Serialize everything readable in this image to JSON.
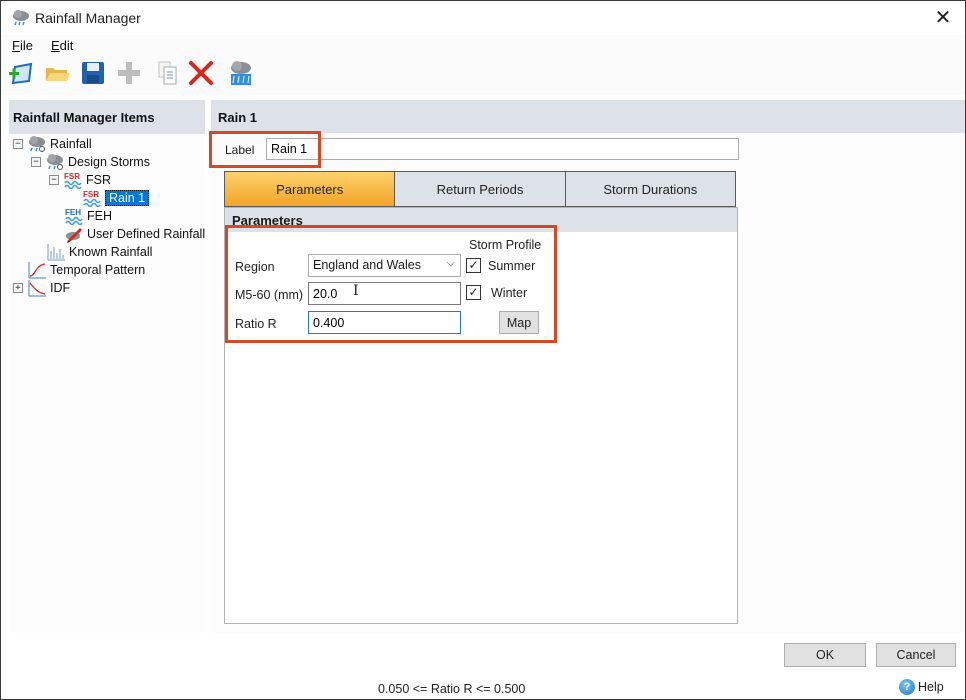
{
  "window": {
    "title": "Rainfall Manager"
  },
  "menu": {
    "file": "File",
    "edit": "Edit"
  },
  "toolbar": {
    "buttons": [
      {
        "icon": "new-icon",
        "label": "New"
      },
      {
        "icon": "open-folder-icon",
        "label": "Open"
      },
      {
        "icon": "save-icon",
        "label": "Save"
      },
      {
        "icon": "add-icon",
        "label": "Add"
      },
      {
        "icon": "copy-icon",
        "label": "Copy"
      },
      {
        "icon": "delete-icon",
        "label": "Delete"
      },
      {
        "icon": "rainfall-icon",
        "label": "Rainfall"
      }
    ]
  },
  "tree": {
    "header": "Rainfall Manager Items",
    "items": [
      {
        "label": "Rainfall",
        "expander": "−",
        "icon": "cloud-rain-icon"
      },
      {
        "label": "Design Storms",
        "expander": "−",
        "icon": "cloud-rain-icon"
      },
      {
        "label": "FSR",
        "expander": "−",
        "icon": "fsr-icon",
        "badge": "FSR"
      },
      {
        "label": "Rain 1",
        "icon": "fsr-icon",
        "badge": "FSR",
        "selected": true
      },
      {
        "label": "FEH",
        "icon": "feh-icon",
        "badge": "FEH"
      },
      {
        "label": "User Defined Rainfall",
        "icon": "pencil-icon"
      },
      {
        "label": "Known Rainfall",
        "icon": "bar-chart-icon"
      },
      {
        "label": "Temporal Pattern",
        "icon": "curve-chart-icon"
      },
      {
        "label": "IDF",
        "expander": "+",
        "icon": "idf-chart-icon"
      }
    ]
  },
  "main": {
    "header": "Rain 1",
    "label_caption": "Label",
    "label_value": "Rain 1",
    "tabs": [
      {
        "label": "Parameters",
        "active": true
      },
      {
        "label": "Return Periods",
        "active": false
      },
      {
        "label": "Storm Durations",
        "active": false
      }
    ],
    "section_title": "Parameters",
    "region_label": "Region",
    "region_value": "England and Wales",
    "m560_label": "M5-60 (mm)",
    "m560_value": "20.0",
    "ratio_label": "Ratio R",
    "ratio_value": "0.400",
    "storm_profile_label": "Storm Profile",
    "summer_label": "Summer",
    "summer_checked": true,
    "winter_label": "Winter",
    "winter_checked": true,
    "map_button": "Map"
  },
  "footer": {
    "ok": "OK",
    "cancel": "Cancel",
    "status": "0.050 <= Ratio R <= 0.500",
    "help": "Help"
  },
  "colors": {
    "highlight": "#d24a26",
    "active_tab": "#f4a428",
    "selection": "#0078d7",
    "header_bg": "#dde2e8"
  }
}
